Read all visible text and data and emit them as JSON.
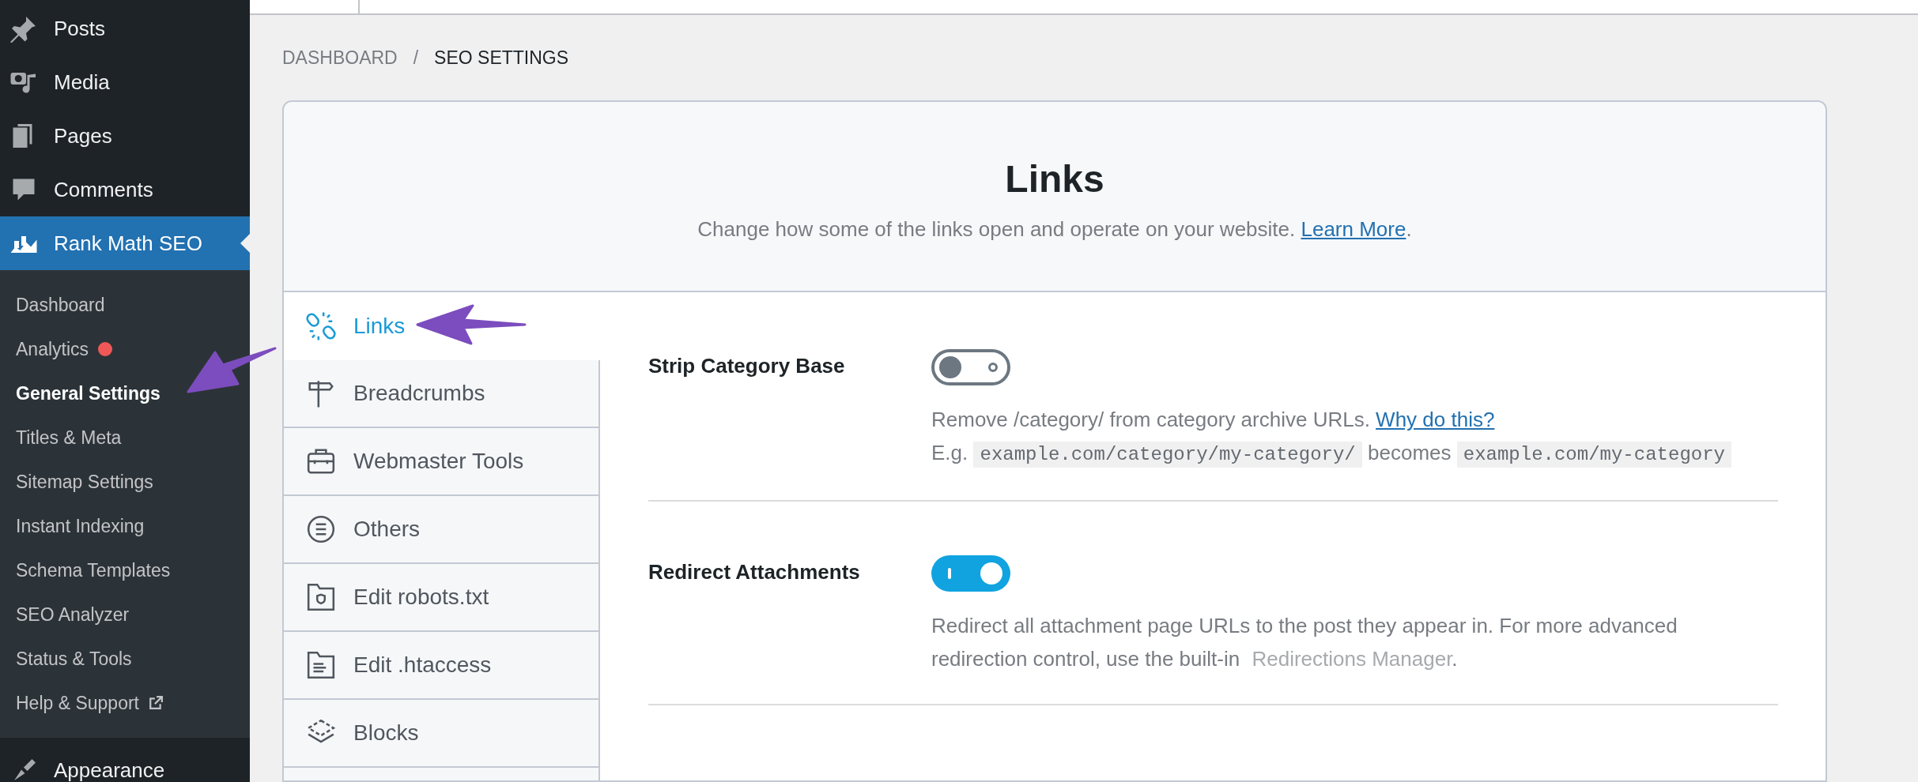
{
  "sidebar": {
    "menu": [
      {
        "label": "Posts",
        "selected": false
      },
      {
        "label": "Media",
        "selected": false
      },
      {
        "label": "Pages",
        "selected": false
      },
      {
        "label": "Comments",
        "selected": false
      },
      {
        "label": "Rank Math SEO",
        "selected": true
      }
    ],
    "submenu": [
      {
        "label": "Dashboard",
        "selected": false,
        "notification_dot": false,
        "external": false
      },
      {
        "label": "Analytics",
        "selected": false,
        "notification_dot": true,
        "external": false
      },
      {
        "label": "General Settings",
        "selected": true,
        "notification_dot": false,
        "external": false
      },
      {
        "label": "Titles & Meta",
        "selected": false,
        "notification_dot": false,
        "external": false
      },
      {
        "label": "Sitemap Settings",
        "selected": false,
        "notification_dot": false,
        "external": false
      },
      {
        "label": "Instant Indexing",
        "selected": false,
        "notification_dot": false,
        "external": false
      },
      {
        "label": "Schema Templates",
        "selected": false,
        "notification_dot": false,
        "external": false
      },
      {
        "label": "SEO Analyzer",
        "selected": false,
        "notification_dot": false,
        "external": false
      },
      {
        "label": "Status & Tools",
        "selected": false,
        "notification_dot": false,
        "external": false
      },
      {
        "label": "Help & Support",
        "selected": false,
        "notification_dot": false,
        "external": true
      }
    ],
    "after_menu": [
      {
        "label": "Appearance",
        "selected": false
      }
    ]
  },
  "breadcrumb": [
    "DASHBOARD",
    "/",
    "SEO SETTINGS"
  ],
  "panel": {
    "title": "Links",
    "subtitle": "Change how some of the links open and operate on your website.",
    "subtitle_link": "Learn More",
    "subtitle_end": "."
  },
  "tabs": [
    {
      "label": "Links",
      "selected": true
    },
    {
      "label": "Breadcrumbs",
      "selected": false
    },
    {
      "label": "Webmaster Tools",
      "selected": false
    },
    {
      "label": "Others",
      "selected": false
    },
    {
      "label": "Edit robots.txt",
      "selected": false
    },
    {
      "label": "Edit .htaccess",
      "selected": false
    },
    {
      "label": "Blocks",
      "selected": false
    }
  ],
  "settings": [
    {
      "label": "Strip Category Base",
      "on": false,
      "description": [
        {
          "kind": "text",
          "text": "Remove /category/ from category archive URLs."
        },
        {
          "kind": "link",
          "text": "Why do this?"
        },
        {
          "kind": "break"
        },
        {
          "kind": "text",
          "text": "E.g."
        },
        {
          "kind": "code",
          "text": "example.com/category/my-category/"
        },
        {
          "kind": "text",
          "text": "becomes"
        },
        {
          "kind": "code",
          "text": "example.com/my-category"
        }
      ]
    },
    {
      "label": "Redirect Attachments",
      "on": true,
      "description": [
        {
          "kind": "text",
          "text": "Redirect all attachment page URLs to the post they appear in. For more advanced redirection control, use the built-in"
        },
        {
          "kind": "muted_link",
          "text": "Redirections Manager"
        },
        {
          "kind": "text",
          "text": "."
        }
      ]
    }
  ]
}
